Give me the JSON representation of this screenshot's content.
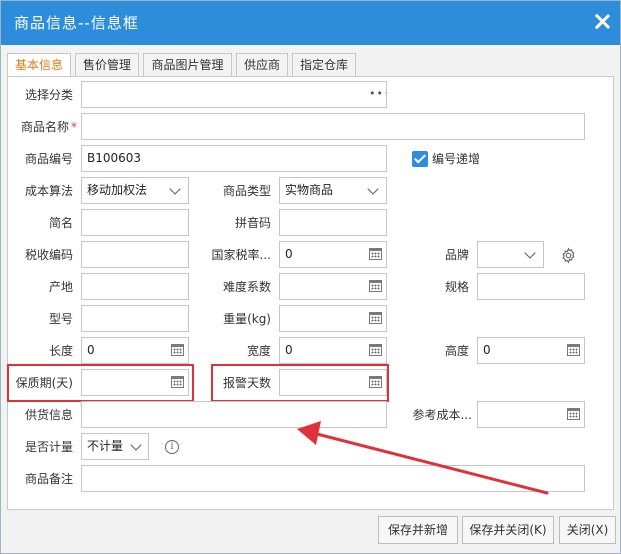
{
  "dialog": {
    "title": "商品信息--信息框"
  },
  "tabs": [
    {
      "label": "基本信息"
    },
    {
      "label": "售价管理"
    },
    {
      "label": "商品图片管理"
    },
    {
      "label": "供应商"
    },
    {
      "label": "指定仓库"
    }
  ],
  "form": {
    "category_label": "选择分类",
    "category_button": "•••",
    "name_label": "商品名称",
    "name_required": "*",
    "code_label": "商品编号",
    "code_value": "B100603",
    "auto_increment_label": "编号递增",
    "cost_method_label": "成本算法",
    "cost_method_value": "移动加权法",
    "product_type_label": "商品类型",
    "product_type_value": "实物商品",
    "short_name_label": "简名",
    "pinyin_label": "拼音码",
    "tax_code_label": "税收编码",
    "tax_rate_label": "国家税率...",
    "tax_rate_value": "0",
    "brand_label": "品牌",
    "origin_label": "产地",
    "difficulty_label": "难度系数",
    "spec_label": "规格",
    "model_label": "型号",
    "weight_label": "重量(kg)",
    "length_label": "长度",
    "length_value": "0",
    "width_label": "宽度",
    "width_value": "0",
    "height_label": "高度",
    "height_value": "0",
    "shelf_life_label": "保质期(天)",
    "alert_days_label": "报警天数",
    "supply_info_label": "供货信息",
    "ref_cost_label": "参考成本...",
    "metering_label": "是否计量",
    "metering_value": "不计量",
    "info_glyph": "i",
    "remark_label": "商品备注"
  },
  "buttons": {
    "save_new": "保存并新增",
    "save_close": "保存并关闭(K)",
    "close": "关闭(X)"
  },
  "colors": {
    "titlebar": "#2d8ddb",
    "active_tab_text": "#e07b17",
    "highlight_red": "#e0313a",
    "checkbox": "#2d8ddb"
  }
}
